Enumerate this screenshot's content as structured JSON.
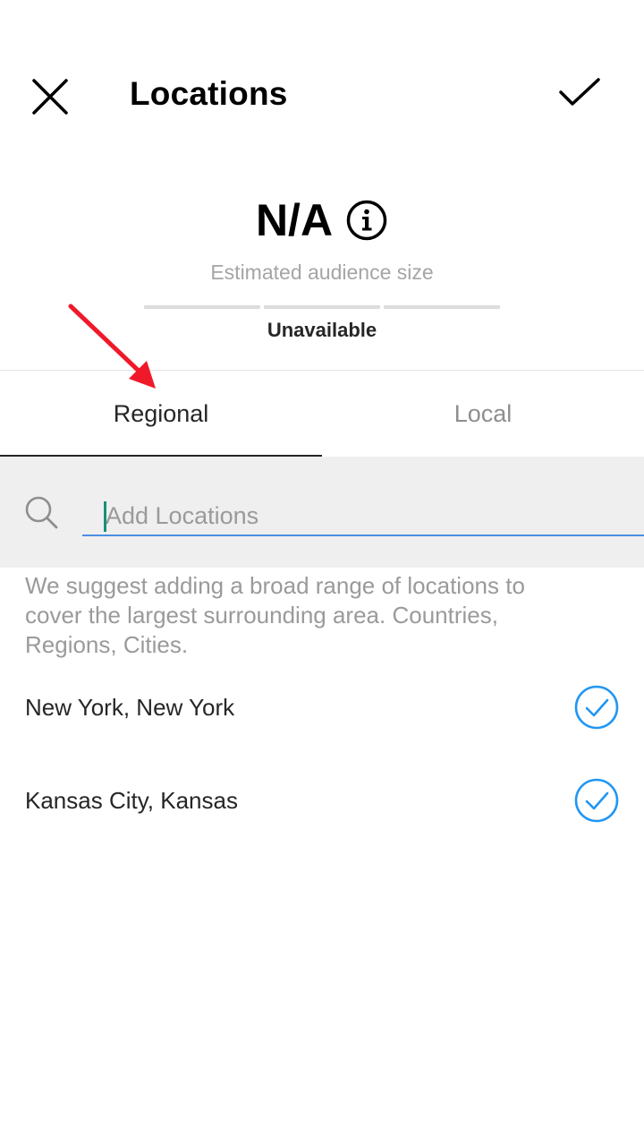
{
  "header": {
    "title": "Locations",
    "close_icon": "close-icon",
    "confirm_icon": "checkmark-icon"
  },
  "audience": {
    "value": "N/A",
    "caption": "Estimated audience size",
    "status": "Unavailable",
    "info_icon": "info-icon"
  },
  "tabs": [
    {
      "label": "Regional",
      "active": true
    },
    {
      "label": "Local",
      "active": false
    }
  ],
  "search": {
    "placeholder": "Add Locations",
    "value": "",
    "icon": "search-icon",
    "underline_color": "#4a90e2"
  },
  "hint": "We suggest adding a broad range of locations to cover the largest surrounding area. Countries, Regions, Cities.",
  "locations": [
    {
      "name": "New York, New York",
      "selected": true
    },
    {
      "name": "Kansas City, Kansas",
      "selected": true
    }
  ],
  "colors": {
    "accent": "#2196f3",
    "annotation_arrow": "#f0192a",
    "search_background": "#efefef"
  }
}
